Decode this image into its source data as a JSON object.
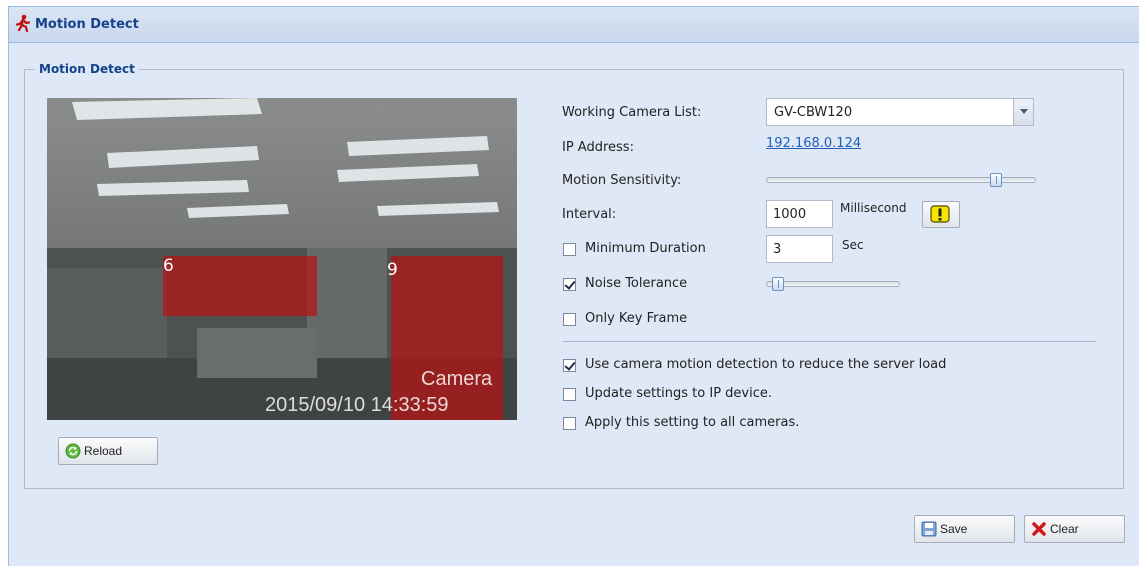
{
  "window": {
    "title": "Motion Detect",
    "title_icon": "running-man-icon"
  },
  "group": {
    "legend": "Motion Detect"
  },
  "preview": {
    "zones": [
      {
        "label": "6"
      },
      {
        "label": "9"
      }
    ],
    "overlay_text": "Camera",
    "timestamp": "2015/09/10 14:33:59",
    "reload_label": "Reload",
    "reload_icon": "refresh-icon"
  },
  "settings": {
    "camera_list_label": "Working Camera List:",
    "camera_selected": "GV-CBW120",
    "ip_label": "IP Address:",
    "ip_value": "192.168.0.124",
    "sensitivity_label": "Motion Sensitivity:",
    "sensitivity_level": 0.87,
    "interval_label": "Interval:",
    "interval_value": "1000",
    "interval_unit": "Millisecond",
    "warning_icon": "exclamation-icon",
    "min_duration_label": "Minimum Duration",
    "min_duration_checked": false,
    "min_duration_value": "3",
    "min_duration_unit": "Sec",
    "noise_tolerance_label": "Noise Tolerance",
    "noise_tolerance_checked": true,
    "noise_tolerance_level": 0.04,
    "only_key_frame_label": "Only Key Frame",
    "only_key_frame_checked": false
  },
  "options": {
    "camera_motion_label": "Use camera motion detection to reduce the server load",
    "camera_motion_checked": true,
    "update_ip_label": "Update settings to IP device.",
    "update_ip_checked": false,
    "apply_all_label": "Apply this setting to all cameras.",
    "apply_all_checked": false
  },
  "footer": {
    "save_label": "Save",
    "save_icon": "floppy-disk-icon",
    "clear_label": "Clear",
    "clear_icon": "red-x-icon"
  },
  "colors": {
    "header_text": "#15428b",
    "panel_bg": "#dfe8f6",
    "link": "#1f5fb8",
    "zone_fill": "#b81414"
  }
}
